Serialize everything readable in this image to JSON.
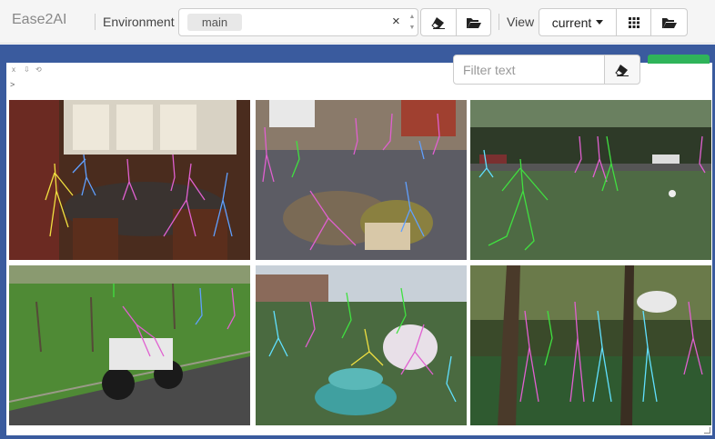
{
  "toolbar": {
    "brand": "Ease2AI",
    "environment_label": "Environment",
    "environment_value": "main",
    "clear_symbol": "×",
    "view_label": "View",
    "view_value": "current"
  },
  "console": {
    "controls": [
      "x",
      "⇩",
      "⟲"
    ],
    "prompt": ">"
  },
  "filter": {
    "placeholder": "Filter text"
  },
  "tiles": [
    {
      "scene": "indoor dining room, people seated around a table with pose skeletons",
      "bg": "#5a3a28"
    },
    {
      "scene": "classroom floor, children and a dog with pose skeletons",
      "bg": "#6a6a70"
    },
    {
      "scene": "soccer field with players and pose skeletons",
      "bg": "#4f6a45"
    },
    {
      "scene": "motorcycle racer on a road beside a grassy field",
      "bg": "#4f8a35"
    },
    {
      "scene": "children around a birthday cake outdoors",
      "bg": "#3f5a4a"
    },
    {
      "scene": "people walking in a park under trees, one with umbrella",
      "bg": "#3e4a2c"
    }
  ],
  "colors": {
    "header_blue": "#3a5b9e",
    "green_button": "#2fb45a",
    "skeleton_pink": "#e060d0",
    "skeleton_cyan": "#60e0ff",
    "skeleton_yellow": "#f0e040",
    "skeleton_green": "#40e040"
  },
  "icons": [
    "eraser-icon",
    "folder-open-icon",
    "grid-icon",
    "caret-down-icon"
  ]
}
